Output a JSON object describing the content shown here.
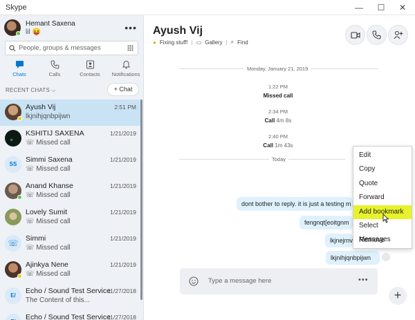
{
  "window": {
    "title": "Skype",
    "minimize": "—",
    "maximize": "☐",
    "close": "✕"
  },
  "profile": {
    "name": "Hemant Saxena",
    "mood": "lil 😝",
    "more": "•••"
  },
  "search": {
    "placeholder": "People, groups & messages"
  },
  "nav": [
    {
      "label": "Chats",
      "icon": "chat-icon"
    },
    {
      "label": "Calls",
      "icon": "phone-icon"
    },
    {
      "label": "Contacts",
      "icon": "contacts-icon"
    },
    {
      "label": "Notifications",
      "icon": "bell-icon"
    }
  ],
  "recent_label": "RECENT CHATS ⌵",
  "new_chat": "+ Chat",
  "conversations": [
    {
      "name": "Ayush Vij",
      "sub": "lkjnihjqnbpijwn",
      "date": "2:51 PM",
      "avatar": "photo",
      "color": "#8a6a4a"
    },
    {
      "name": "KSHITIJ SAXENA",
      "sub": "Missed call",
      "date": "1/21/2019",
      "avatar": "photo",
      "color": "#0d1a14"
    },
    {
      "name": "Simmi Saxena",
      "sub": "Missed call",
      "date": "1/21/2019",
      "avatar": "SS",
      "color": "#dbe9f8"
    },
    {
      "name": "Anand Khanse",
      "sub": "Missed call",
      "date": "1/21/2019",
      "avatar": "photo",
      "color": "#7a6a5c"
    },
    {
      "name": "Lovely Sumit",
      "sub": "Missed call",
      "date": "1/21/2019",
      "avatar": "photo",
      "color": "#9aa86a"
    },
    {
      "name": "Simmi",
      "sub": "Missed call",
      "date": "1/21/2019",
      "avatar": "phone",
      "color": "#dbe9f8"
    },
    {
      "name": "Ajinkya Nene",
      "sub": "Missed call",
      "date": "1/21/2019",
      "avatar": "photo",
      "color": "#6b4b3a"
    },
    {
      "name": "Echo / Sound Test Service",
      "sub": "The Content of this...",
      "date": "11/27/2018",
      "avatar": "E/",
      "color": "#dbe9f8"
    },
    {
      "name": "Echo / Sound Test Service",
      "sub": "",
      "date": "11/27/2018",
      "avatar": "E/",
      "color": "#dbe9f8"
    }
  ],
  "chat": {
    "name": "Ayush Vij",
    "status": "Fixing stuff!",
    "gallery": "Gallery",
    "find": "Find",
    "date_sep": "Monday, January 21, 2019",
    "today_sep": "Today",
    "events": [
      {
        "time": "1:22 PM",
        "bold": "Missed call",
        "rest": ""
      },
      {
        "time": "2:34 PM",
        "bold": "Call",
        "rest": " 4m 8s"
      },
      {
        "time": "2:40 PM",
        "bold": "Call",
        "rest": " 1m 43s"
      }
    ],
    "messages": [
      "dont bother to reply. it is just a testing m",
      "fengnqt[eoitgnm",
      "lkjnejrnvp",
      "lkjnihjqnbpijwn"
    ],
    "composer_placeholder": "Type a message here"
  },
  "context_menu": [
    "Edit",
    "Copy",
    "Quote",
    "Forward",
    "Add bookmark",
    "Select Messages",
    "Remove"
  ],
  "highlight_color": "#e8f22c",
  "accent": "#0078d4"
}
